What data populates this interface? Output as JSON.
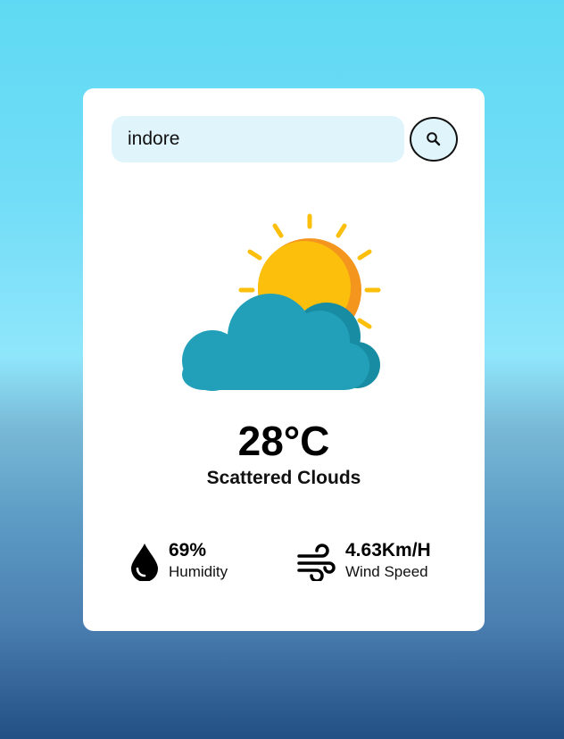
{
  "search": {
    "value": "indore",
    "button_icon": "search-icon"
  },
  "weather": {
    "icon": "sun-behind-cloud-icon",
    "temperature": "28°C",
    "condition": "Scattered Clouds"
  },
  "stats": {
    "humidity": {
      "icon": "water-drop-icon",
      "value": "69%",
      "label": "Humidity"
    },
    "wind": {
      "icon": "wind-icon",
      "value": "4.63Km/H",
      "label": "Wind Speed"
    }
  },
  "colors": {
    "card": "#ffffff",
    "input_background": "#e0f4fc",
    "sun": "#fbbf0c",
    "sun_shade": "#f4961e",
    "cloud": "#23a0b9",
    "cloud_shade": "#178ca3"
  }
}
